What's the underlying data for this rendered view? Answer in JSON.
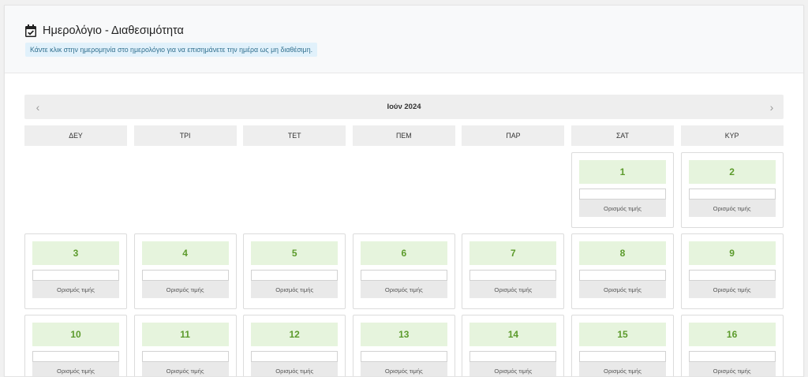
{
  "header": {
    "title": "Ημερολόγιο - Διαθεσιμότητα",
    "hint": "Κάντε κλικ στην ημερομηνία στο ημερολόγιο για να επισημάνετε την ημέρα ως μη διαθέσιμη."
  },
  "calendar": {
    "month_label": "Ιούν 2024",
    "weekdays": [
      "ΔΕΥ",
      "ΤΡΙ",
      "ΤΕΤ",
      "ΠΕΜ",
      "ΠΑΡ",
      "ΣΑΤ",
      "ΚΥΡ"
    ],
    "first_weekday_index": 5,
    "days": [
      "1",
      "2",
      "3",
      "4",
      "5",
      "6",
      "7",
      "8",
      "9",
      "10",
      "11",
      "12",
      "13",
      "14",
      "15",
      "16"
    ],
    "set_price_label": "Ορισμός τιμής"
  },
  "icons": {
    "title": "calendar-check-icon",
    "prev": "chevron-left-icon",
    "next": "chevron-right-icon"
  },
  "colors": {
    "day_number": "#5c9b2c",
    "day_background": "#e6f4dd",
    "hint_background": "#e1f1fb",
    "hint_text": "#31708f"
  }
}
